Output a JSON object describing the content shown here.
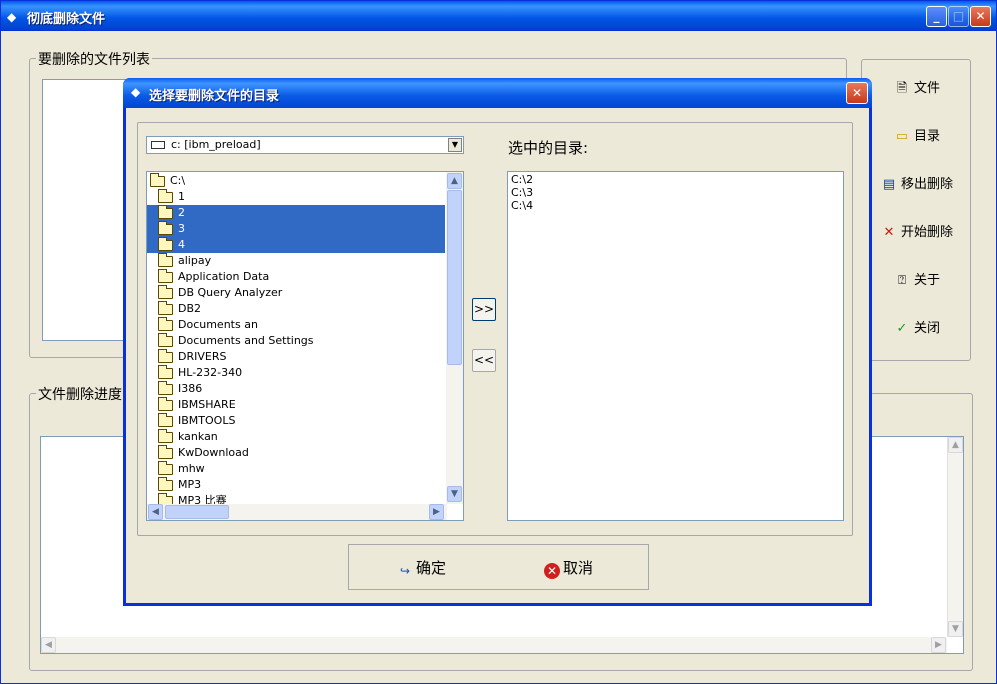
{
  "window": {
    "title": "彻底删除文件",
    "controls": [
      "minimize",
      "maximize",
      "close"
    ]
  },
  "file_list_group": {
    "legend": "要删除的文件列表"
  },
  "progress_group": {
    "legend": "文件删除进度"
  },
  "side_buttons": [
    {
      "label": "文件",
      "icon": "file-icon"
    },
    {
      "label": "目录",
      "icon": "folder-icon"
    },
    {
      "label": "移出删除",
      "icon": "remove-icon"
    },
    {
      "label": "开始删除",
      "icon": "x-icon"
    },
    {
      "label": "关于",
      "icon": "about-icon"
    },
    {
      "label": "关闭",
      "icon": "check-icon"
    }
  ],
  "dialog": {
    "title": "选择要删除文件的目录",
    "drive_select": "c: [ibm_preload]",
    "tree": {
      "root": "C:\\",
      "items": [
        "1",
        "2",
        "3",
        "4",
        "alipay",
        "Application Data",
        "DB Query Analyzer",
        "DB2",
        "Documents an",
        "Documents and Settings",
        "DRIVERS",
        "HL-232-340",
        "I386",
        "IBMSHARE",
        "IBMTOOLS",
        "kankan",
        "KwDownload",
        "mhw",
        "MP3",
        "MP3 比赛"
      ],
      "selected": [
        "2",
        "3",
        "4"
      ]
    },
    "add_button": ">>",
    "remove_button": "<<",
    "selected_label": "选中的目录:",
    "selected_dirs": [
      "C:\\2",
      "C:\\3",
      "C:\\4"
    ],
    "ok_button": "确定",
    "cancel_button": "取消"
  },
  "colors": {
    "titlebar": "#0055e5",
    "selection": "#316ac5",
    "window_bg": "#ece9d8"
  }
}
